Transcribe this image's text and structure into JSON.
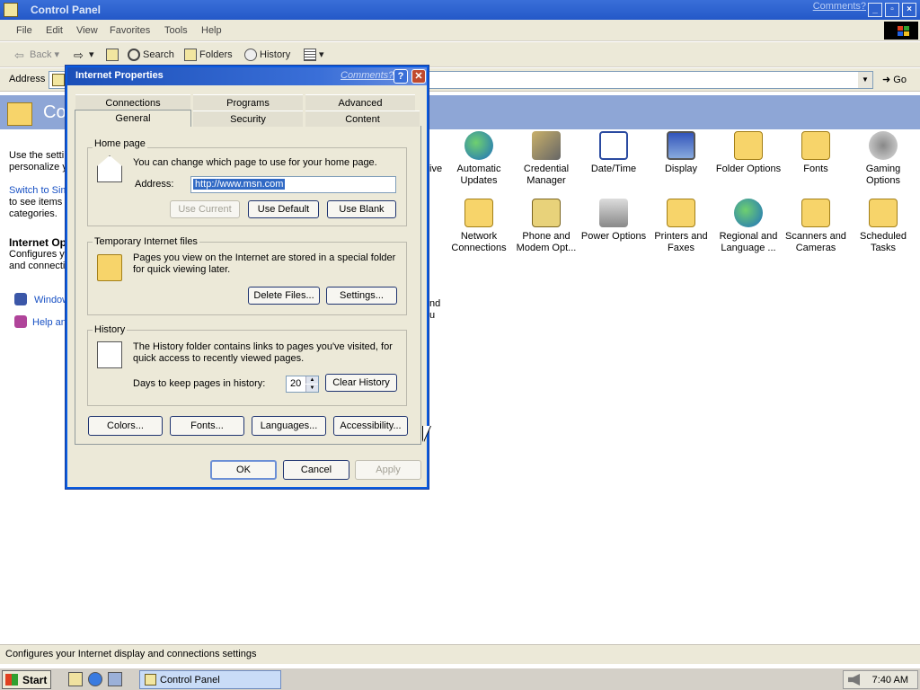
{
  "window": {
    "title": "Control Panel",
    "comments_link": "Comments?"
  },
  "menubar": {
    "items": [
      "File",
      "Edit",
      "View",
      "Favorites",
      "Tools",
      "Help"
    ]
  },
  "toolbar": {
    "back": "Back",
    "search": "Search",
    "folders": "Folders",
    "history": "History"
  },
  "addressbar": {
    "label": "Address",
    "go": "Go"
  },
  "header": {
    "title_fragment": "Co"
  },
  "sidebar": {
    "intro": [
      "Use the setti",
      "personalize y"
    ],
    "switch_link": "Switch to Sim",
    "switch_text": [
      "to see items",
      "categories."
    ],
    "section_title": "Internet Op",
    "section_desc": [
      "Configures y",
      "and connecti"
    ],
    "links": [
      "Window",
      "Help an"
    ]
  },
  "main_fragments": {
    "behind_dialog_1": "ive",
    "behind_dialog_2": [
      "nd",
      "u"
    ]
  },
  "cp_items": [
    {
      "label": "Automatic Updates",
      "icon": "automatic-updates-icon"
    },
    {
      "label": "Credential Manager",
      "icon": "credential-manager-icon"
    },
    {
      "label": "Date/Time",
      "icon": "date-time-icon"
    },
    {
      "label": "Display",
      "icon": "display-icon"
    },
    {
      "label": "Folder Options",
      "icon": "folder-options-icon"
    },
    {
      "label": "Fonts",
      "icon": "fonts-icon"
    },
    {
      "label": "Gaming Options",
      "icon": "gaming-options-icon"
    },
    {
      "label": "Network Connections",
      "icon": "network-connections-icon"
    },
    {
      "label": "Phone and Modem Opt...",
      "icon": "phone-modem-icon"
    },
    {
      "label": "Power Options",
      "icon": "power-options-icon"
    },
    {
      "label": "Printers and Faxes",
      "icon": "printers-faxes-icon"
    },
    {
      "label": "Regional and Language ...",
      "icon": "regional-language-icon"
    },
    {
      "label": "Scanners and Cameras",
      "icon": "scanners-cameras-icon"
    },
    {
      "label": "Scheduled Tasks",
      "icon": "scheduled-tasks-icon"
    }
  ],
  "statusbar": {
    "text": "Configures your Internet display and connections settings"
  },
  "taskbar": {
    "start": "Start",
    "task": "Control Panel",
    "clock": "7:40 AM"
  },
  "dialog": {
    "title": "Internet Properties",
    "comments_link": "Comments?",
    "help_glyph": "?",
    "close_glyph": "✕",
    "tabs_back": [
      "Connections",
      "Programs",
      "Advanced"
    ],
    "tabs_front": [
      "General",
      "Security",
      "Content"
    ],
    "home_page": {
      "group": "Home page",
      "text": "You can change which page to use for your home page.",
      "address_label": "Address:",
      "address_value": "http://www.msn.com",
      "use_current": "Use Current",
      "use_default": "Use Default",
      "use_blank": "Use Blank"
    },
    "temp_files": {
      "group": "Temporary Internet files",
      "text": "Pages you view on the Internet are stored in a special folder for quick viewing later.",
      "delete_files": "Delete Files...",
      "settings": "Settings..."
    },
    "history": {
      "group": "History",
      "text": "The History folder contains links to pages you've visited, for quick access to recently viewed pages.",
      "days_label": "Days to keep pages in history:",
      "days_value": "20",
      "clear": "Clear History"
    },
    "bottom_buttons": {
      "colors": "Colors...",
      "fonts": "Fonts...",
      "languages": "Languages...",
      "accessibility": "Accessibility..."
    },
    "ok": "OK",
    "cancel": "Cancel",
    "apply": "Apply"
  },
  "colors": {
    "titlebar": "#2458c8",
    "dialog_border": "#0a5be0",
    "selection": "#316ac5",
    "link": "#1750c4"
  }
}
